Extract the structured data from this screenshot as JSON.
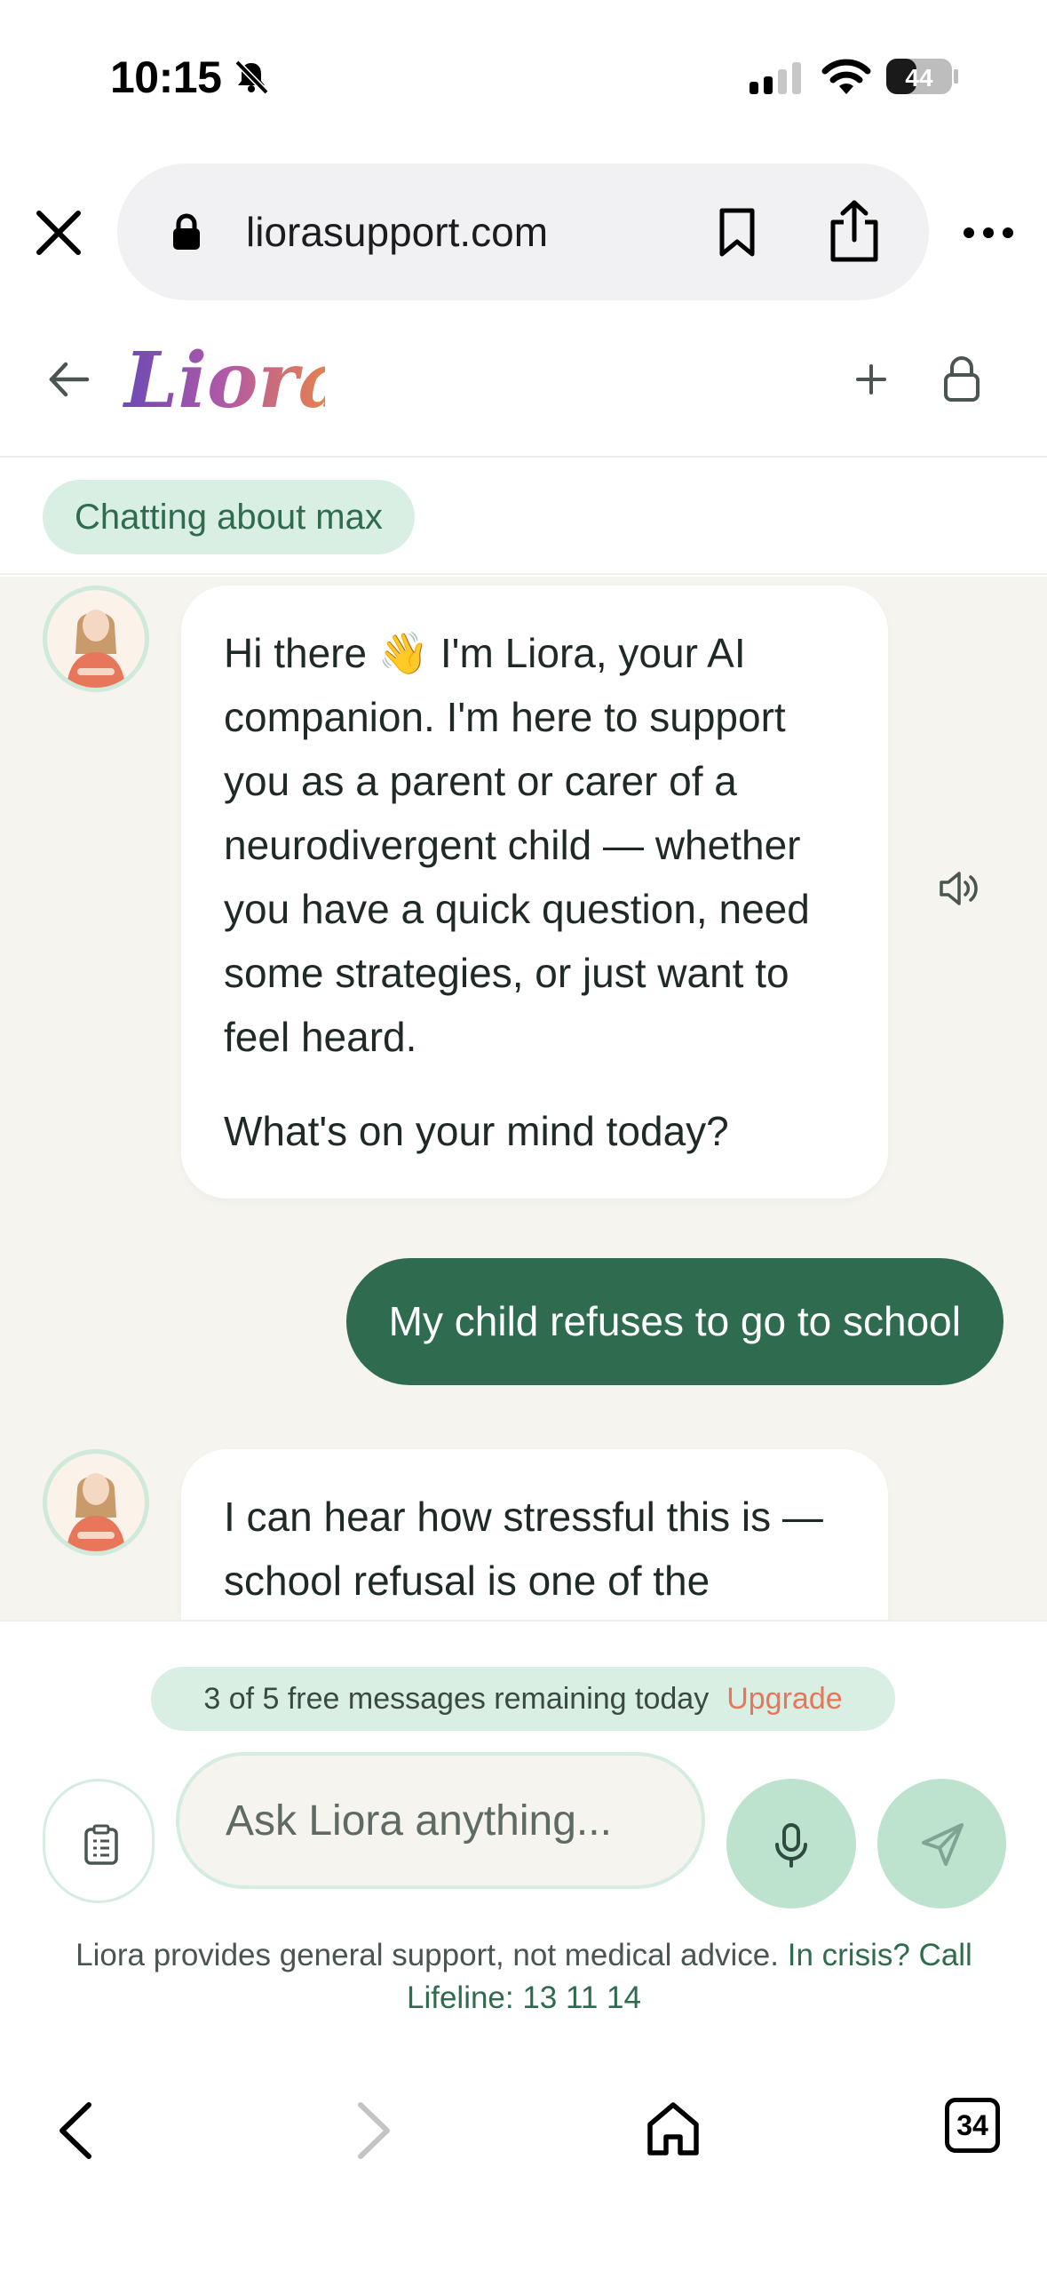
{
  "status_bar": {
    "time": "10:15",
    "battery": "44"
  },
  "browser": {
    "url": "liorasupport.com",
    "tab_count": "34"
  },
  "header": {
    "logo_text": "Liora"
  },
  "context": {
    "chip_label": "Chatting about max"
  },
  "messages": {
    "bot_1_p1": "Hi there 👋 I'm Liora, your AI companion. I'm here to support you as a parent or carer of a neurodivergent child — whether you have a quick question, need some strategies, or just want to feel heard.",
    "bot_1_p2": "What's on your mind today?",
    "user_1": "My child refuses to go to school",
    "bot_2_partial": "I can hear how stressful this is — school refusal is one of the"
  },
  "composer": {
    "quota_text": "3 of 5 free messages remaining today",
    "upgrade_label": "Upgrade",
    "placeholder": "Ask Liora anything...",
    "disclaimer": "Liora provides general support, not medical advice.",
    "crisis_text": "In crisis? Call Lifeline: 13 11 14"
  },
  "colors": {
    "brand_green": "#2f6b4e",
    "mint": "#d9efe3",
    "chat_bg": "#f5f4ee",
    "upgrade_accent": "#e8765a"
  },
  "icons": {
    "status": [
      "bell-off-icon",
      "signal-icon",
      "wifi-icon",
      "battery-icon"
    ],
    "browser": [
      "close-icon",
      "lock-icon",
      "bookmark-icon",
      "share-icon",
      "more-icon"
    ],
    "header": [
      "back-arrow-icon",
      "plus-icon",
      "lock-icon"
    ],
    "chat": [
      "speaker-icon"
    ],
    "composer": [
      "clipboard-icon",
      "microphone-icon",
      "send-icon"
    ],
    "nav": [
      "chevron-left-icon",
      "chevron-right-icon",
      "home-icon",
      "tabs-icon"
    ]
  }
}
